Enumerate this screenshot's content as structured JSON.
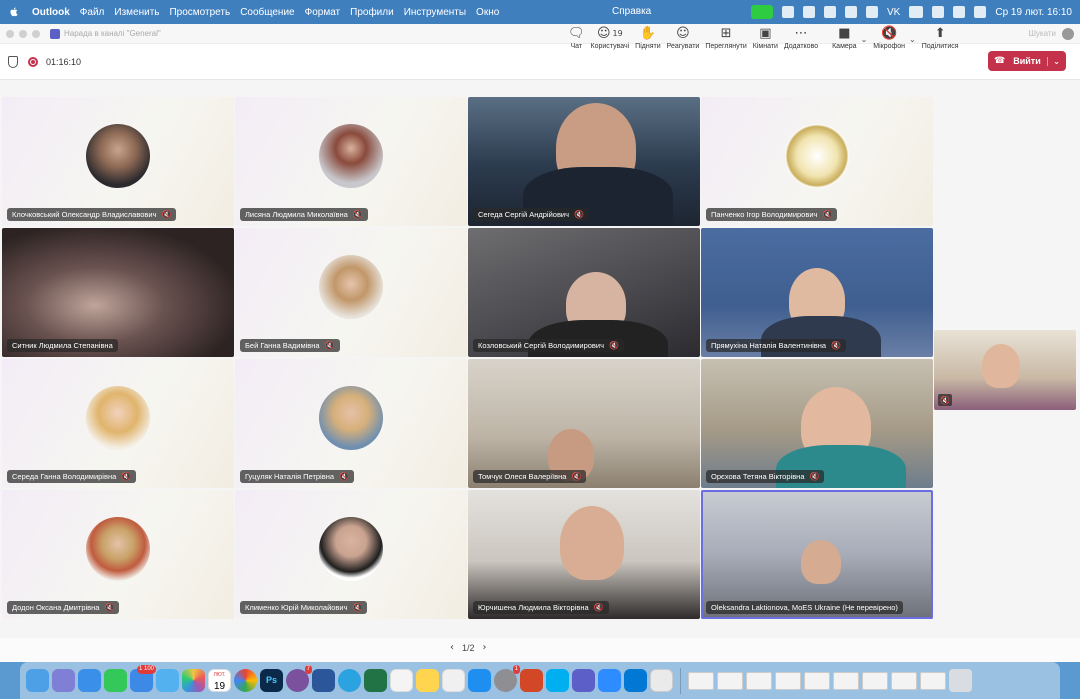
{
  "menubar": {
    "app_name": "Outlook",
    "menus": [
      "Файл",
      "Изменить",
      "Просмотреть",
      "Сообщение",
      "Формат",
      "Профили",
      "Инструменты",
      "Окно"
    ],
    "help": "Справка",
    "clock": "Ср 19 лют.  16:10",
    "vk_label": "VK"
  },
  "window": {
    "title": "Нарада в каналі \"General\"",
    "search_hint": "Шукати"
  },
  "toolbar": {
    "timer": "01:16:10",
    "chat": "Чат",
    "people_count": "19",
    "people": "Користувачі",
    "raise": "Підняти",
    "react": "Реагувати",
    "view": "Переглянути",
    "rooms": "Кімнати",
    "more": "Додатково",
    "camera": "Камера",
    "mic": "Мікрофон",
    "share": "Поділитися",
    "leave": "Вийти"
  },
  "participants": [
    {
      "name": "Клочковський Олександр Владиславович",
      "kind": "avatar"
    },
    {
      "name": "Лисяна Людмила Миколаївна",
      "kind": "avatar"
    },
    {
      "name": "Сегеда Сергій Андрійович",
      "kind": "video"
    },
    {
      "name": "Панченко Ігор Володимирович",
      "kind": "avatar"
    },
    {
      "name": "Ситник Людмила Степанівна",
      "kind": "video"
    },
    {
      "name": "Бей Ганна Вадимівна",
      "kind": "avatar"
    },
    {
      "name": "Козловський Сергій Володимирович",
      "kind": "video"
    },
    {
      "name": "Прямухіна Наталія Валентинівна",
      "kind": "video"
    },
    {
      "name": "Середа Ганна Володимирівна",
      "kind": "avatar"
    },
    {
      "name": "Гуцуляк Наталія Петрівна",
      "kind": "avatar"
    },
    {
      "name": "Томчук Олеся Валеріївна",
      "kind": "video"
    },
    {
      "name": "Орєхова Тетяна Вікторівна",
      "kind": "video"
    },
    {
      "name": "Додон Оксана Дмитрівна",
      "kind": "avatar"
    },
    {
      "name": "Клименко Юрій Миколайович",
      "kind": "avatar"
    },
    {
      "name": "Юрчишена Людмила Вікторівна",
      "kind": "video"
    },
    {
      "name": "Oleksandra Laktionova, MoES Ukraine (Не перевірено)",
      "kind": "video"
    }
  ],
  "pager": {
    "label": "1/2"
  },
  "dock": {
    "calendar_day": "19",
    "calendar_month": "ЛЮТ.",
    "badge_mail": "1 100",
    "badge_viber": "7",
    "badge_settings": "1"
  },
  "colors": {
    "accent": "#5b5fc7",
    "leave": "#c4314b",
    "menubar": "#3f7fbe"
  }
}
